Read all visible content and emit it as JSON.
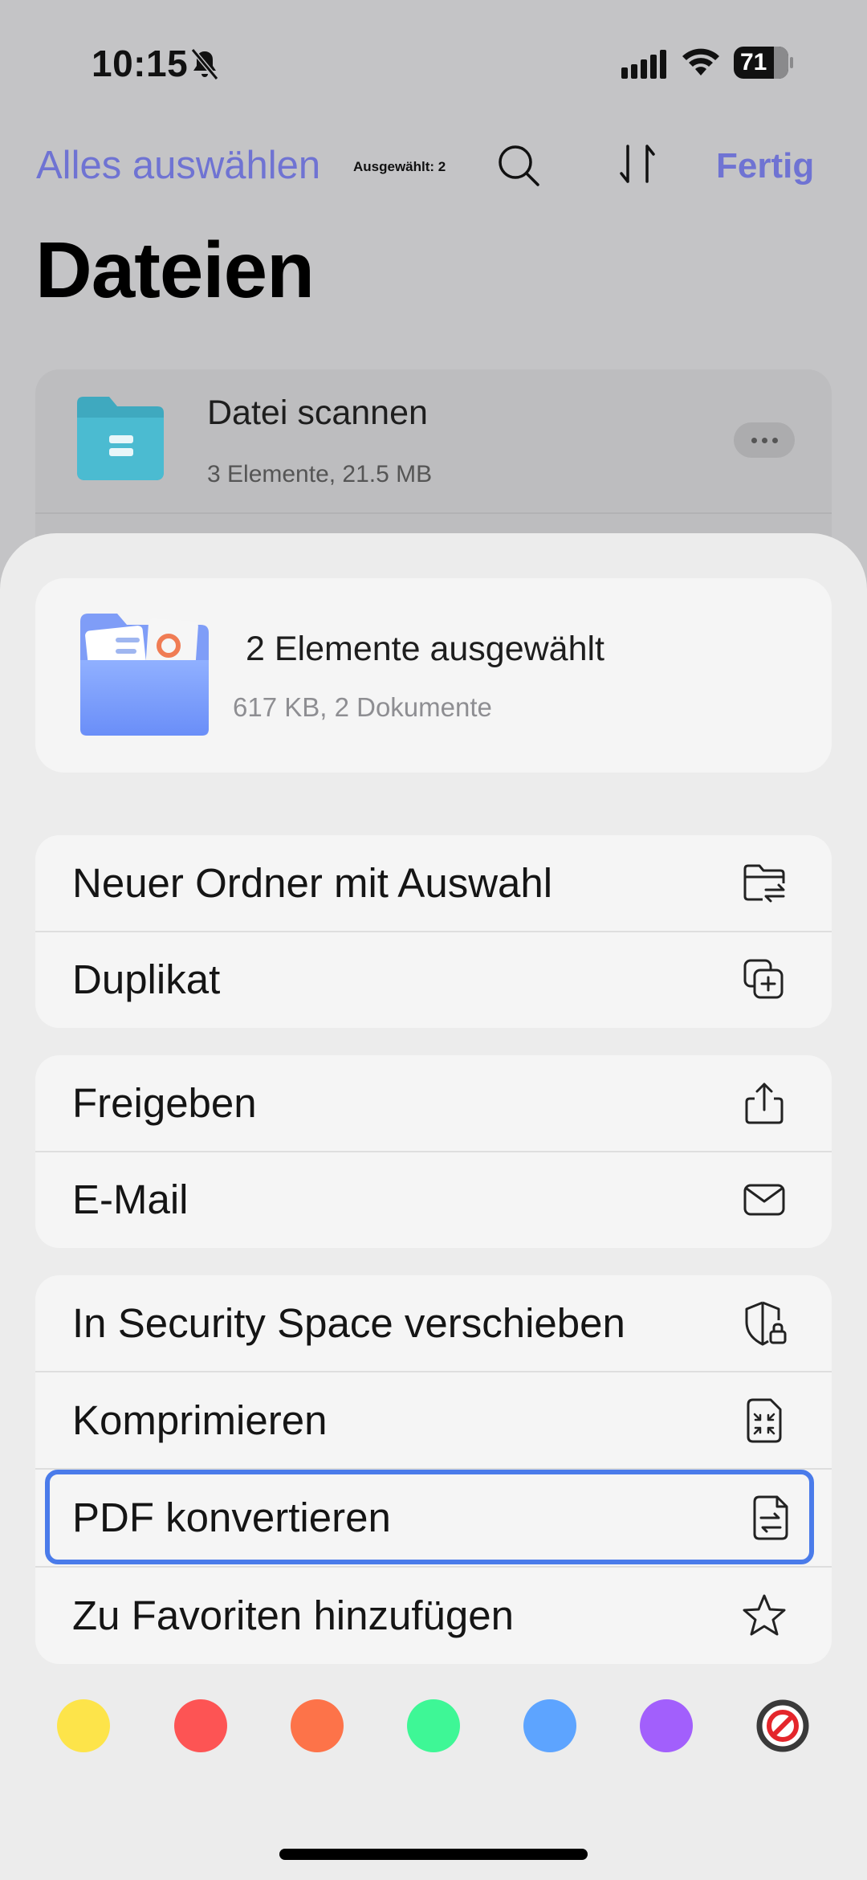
{
  "status_bar": {
    "time": "10:15",
    "battery": "71",
    "icons": [
      "bell-slash-icon",
      "cellular-signal-icon",
      "wifi-icon",
      "battery-icon"
    ]
  },
  "nav": {
    "select_all": "Alles auswählen",
    "selected_count": "Ausgewählt: 2",
    "done": "Fertig",
    "icons": [
      "search-icon",
      "sort-icon"
    ]
  },
  "page_title": "Dateien",
  "background_item": {
    "name": "Datei scannen",
    "meta": "3 Elemente, 21.5 MB"
  },
  "selection": {
    "title": "2 Elemente ausgewählt",
    "meta": "617 KB, 2 Dokumente"
  },
  "actions": {
    "group1": [
      {
        "label": "Neuer Ordner mit Auswahl",
        "icon": "folder-move-icon"
      },
      {
        "label": "Duplikat",
        "icon": "duplicate-icon"
      }
    ],
    "group2": [
      {
        "label": "Freigeben",
        "icon": "share-icon"
      },
      {
        "label": "E-Mail",
        "icon": "mail-icon"
      }
    ],
    "group3": [
      {
        "label": "In Security Space verschieben",
        "icon": "shield-lock-icon"
      },
      {
        "label": "Komprimieren",
        "icon": "compress-icon"
      },
      {
        "label": "PDF konvertieren",
        "icon": "convert-file-icon"
      },
      {
        "label": "Zu Favoriten hinzufügen",
        "icon": "star-icon"
      }
    ]
  },
  "color_tags": [
    "#fde44a",
    "#fd5454",
    "#fd7349",
    "#3ef796",
    "#5da4ff",
    "#a25ffc",
    "none"
  ],
  "accent_color": "#6f73d3",
  "highlight_color": "#4a7bea"
}
